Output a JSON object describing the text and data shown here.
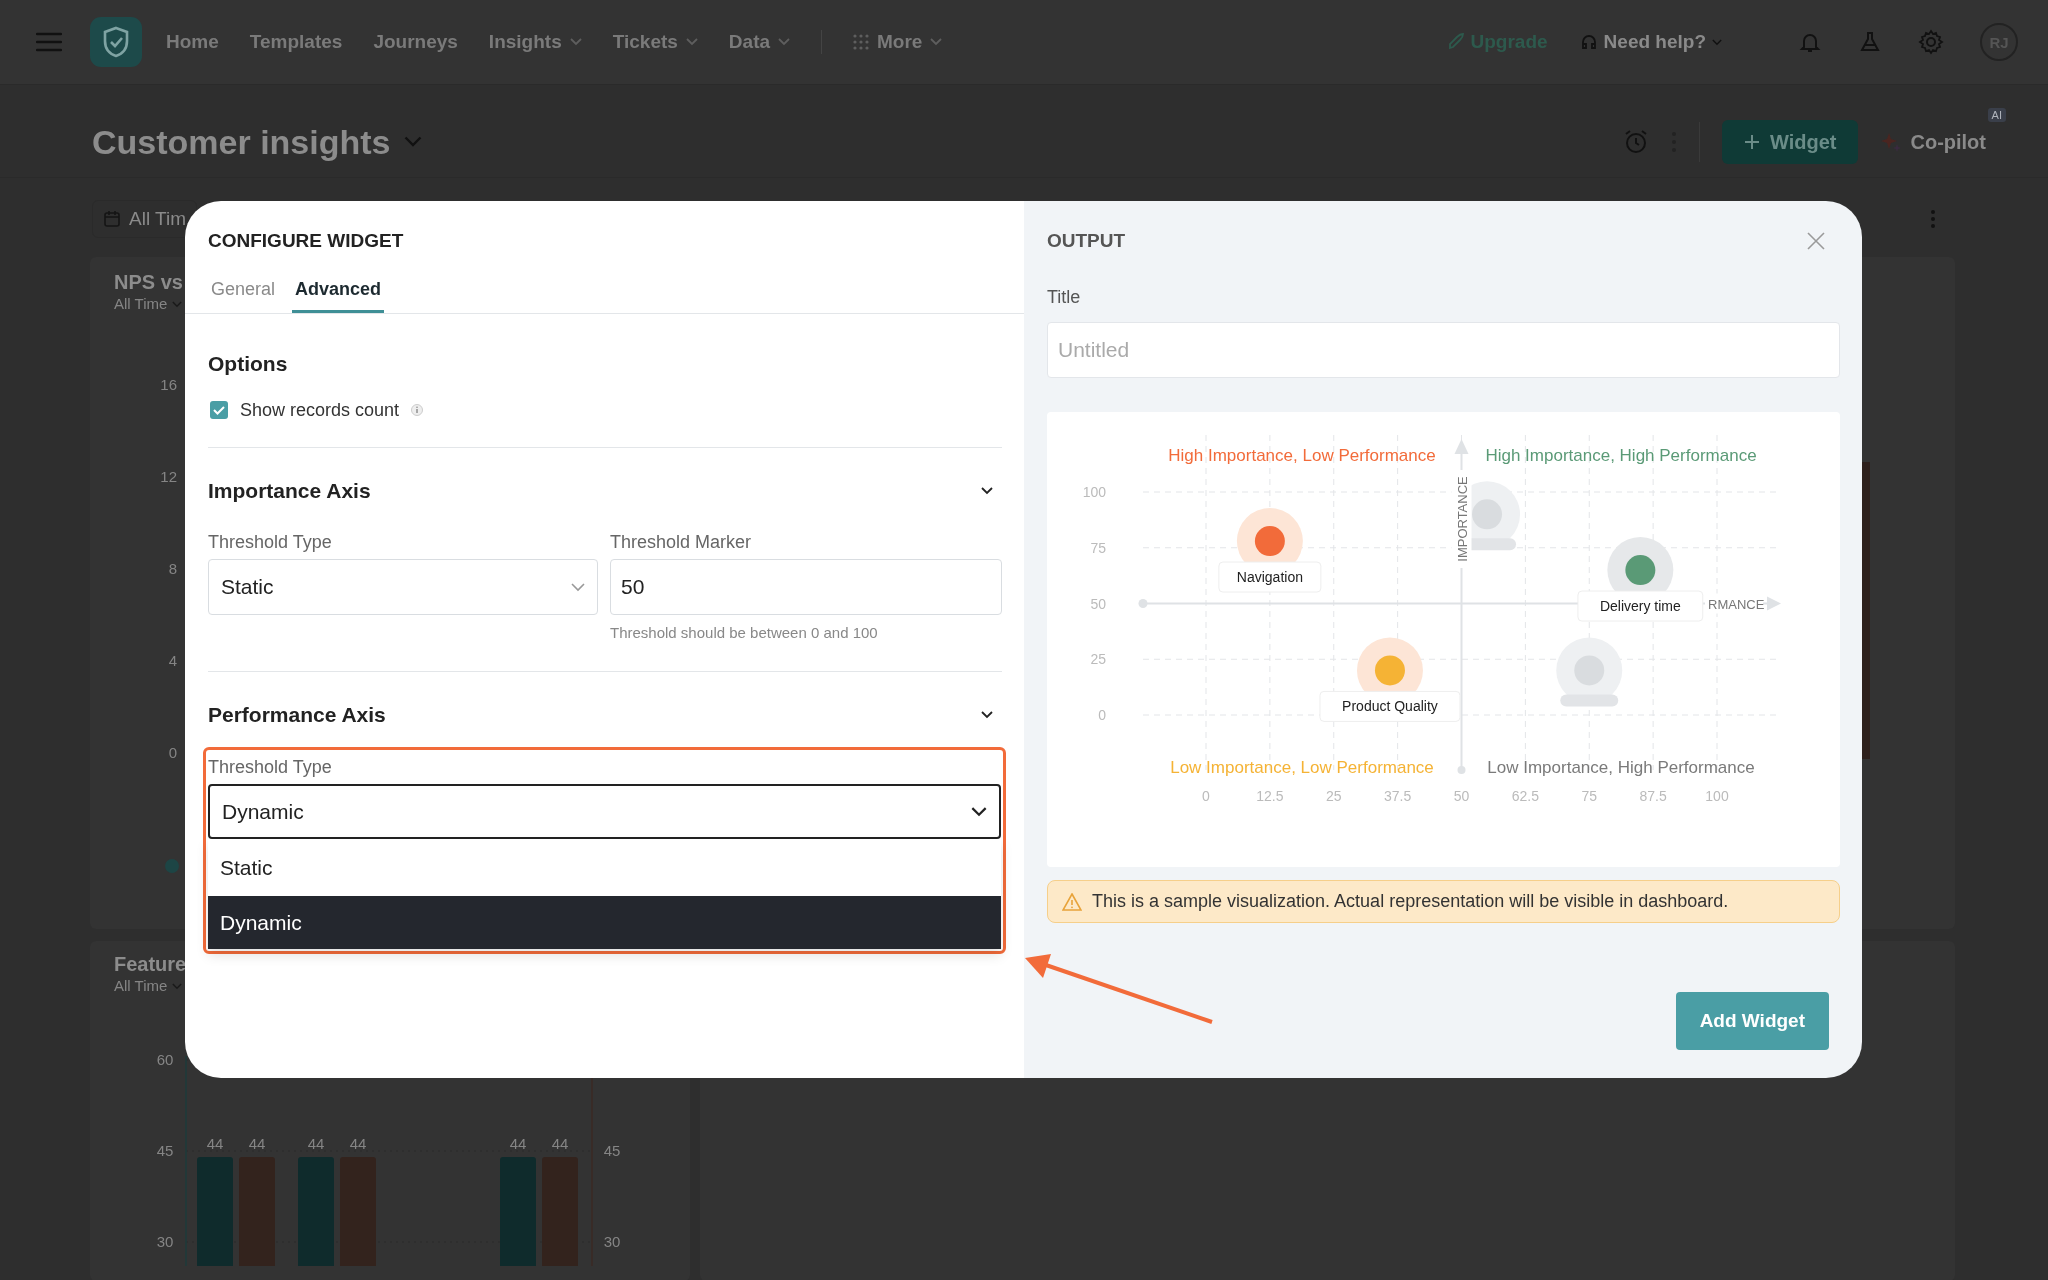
{
  "nav": {
    "items": [
      {
        "label": "Home",
        "kind": "link",
        "has_menu": false
      },
      {
        "label": "Templates",
        "kind": "link",
        "has_menu": false
      },
      {
        "label": "Journeys",
        "kind": "link",
        "has_menu": false
      },
      {
        "label": "Insights",
        "kind": "link",
        "has_menu": true
      },
      {
        "label": "Tickets",
        "kind": "link",
        "has_menu": true
      },
      {
        "label": "Data",
        "kind": "link",
        "has_menu": true
      },
      {
        "label": "More",
        "kind": "apps",
        "has_menu": true
      }
    ],
    "upgrade": "Upgrade",
    "help": "Need help?",
    "avatar": "RJ"
  },
  "page": {
    "title": "Customer insights",
    "widget_button": "Widget",
    "copilot": "Co-pilot",
    "ai_badge": "AI",
    "date_filter": "All Tim"
  },
  "cards": [
    {
      "title": "NPS vs",
      "period": "All Time",
      "axis_labels": [
        "16",
        "12",
        "8",
        "4",
        "0"
      ]
    },
    {
      "title": "Feature",
      "period": "All Time",
      "axis_labels": [
        "60",
        "45",
        "30"
      ],
      "right_axis_labels": [
        "45",
        "30"
      ],
      "bar_labels": [
        "44",
        "44",
        "44",
        "44",
        "44",
        "44"
      ]
    }
  ],
  "modal": {
    "title": "CONFIGURE WIDGET",
    "tabs": [
      {
        "label": "General",
        "selected": false
      },
      {
        "label": "Advanced",
        "selected": true
      }
    ],
    "options": {
      "title": "Options",
      "checkboxes": [
        {
          "label": "Show records count",
          "checked": true
        }
      ]
    },
    "sections": [
      {
        "title": "Importance Axis",
        "expanded": true,
        "threshold_type": {
          "label": "Threshold Type",
          "value": "Static"
        },
        "threshold_marker": {
          "label": "Threshold Marker",
          "value": "50",
          "hint": "Threshold should be between 0 and 100"
        }
      },
      {
        "title": "Performance Axis",
        "expanded": true,
        "threshold_type": {
          "label": "Threshold Type",
          "value": "Dynamic",
          "open": true,
          "highlighted": true,
          "options": [
            {
              "label": "Static",
              "selected": false
            },
            {
              "label": "Dynamic",
              "selected": true
            }
          ]
        }
      }
    ]
  },
  "output": {
    "title": "OUTPUT",
    "title_field": {
      "label": "Title",
      "placeholder": "Untitled"
    },
    "chart": {
      "quadrant_labels": [
        {
          "text": "High Importance, Low Performance",
          "color": "#f26b3a"
        },
        {
          "text": "High Importance, High Performance",
          "color": "#5a9a76"
        },
        {
          "text": "Low Importance, Low Performance",
          "color": "#f5b335"
        },
        {
          "text": "Low Importance, High Performance",
          "color": "#7a7a7a"
        }
      ],
      "chart_data": {
        "type": "scatter",
        "grid": true,
        "xlabel": "RMANCE",
        "ylabel": "IMPORTANCE",
        "xlim": [
          0,
          100
        ],
        "ylim": [
          0,
          100
        ],
        "xticks": [
          0,
          12.5,
          25,
          37.5,
          50,
          62.5,
          75,
          87.5,
          100
        ],
        "yticks": [
          0,
          25,
          50,
          75,
          100
        ],
        "series": [
          {
            "name": "Navigation",
            "color": "#f26b3a",
            "x": [
              12.5
            ],
            "values": [
              78
            ]
          },
          {
            "name": "Product Quality",
            "color": "#f5b335",
            "x": [
              36
            ],
            "values": [
              20
            ]
          },
          {
            "name": "Delivery time",
            "color": "#5a9a76",
            "x": [
              85
            ],
            "values": [
              65
            ]
          },
          {
            "color": "#d9dcdf",
            "x": [
              55,
              75
            ],
            "values": [
              90,
              20
            ]
          }
        ]
      }
    },
    "notice": "This is a sample visualization. Actual representation will be visible in dashboard.",
    "add_button": "Add Widget"
  }
}
